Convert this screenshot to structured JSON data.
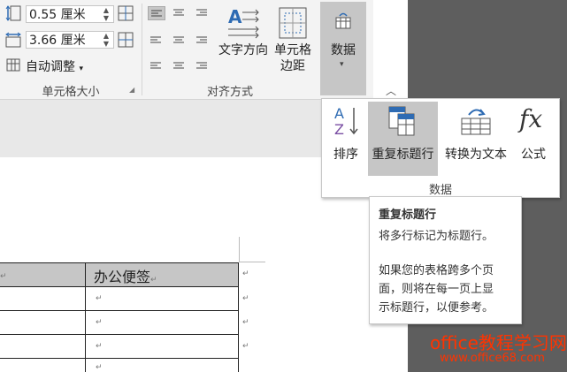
{
  "cell_size": {
    "height_value": "0.55 厘米",
    "width_value": "3.66 厘米",
    "autofit_label": "自动调整",
    "group_label": "单元格大小"
  },
  "alignment": {
    "text_direction_label": "文字方向",
    "cell_margin_label_1": "单元格",
    "cell_margin_label_2": "边距",
    "group_label": "对齐方式"
  },
  "data_button": {
    "label": "数据"
  },
  "popup": {
    "sort_label": "排序",
    "repeat_header_label": "重复标题行",
    "convert_label": "转换为文本",
    "formula_label": "公式",
    "group_label": "数据"
  },
  "tooltip": {
    "title": "重复标题行",
    "line1": "将多行标记为标题行。",
    "body_line1": "如果您的表格跨多个页",
    "body_line2": "面，则将在每一页上显",
    "body_line3": "示标题行，以便参考。"
  },
  "document": {
    "header_cell": "办公便签",
    "cell_mark": "↵"
  },
  "watermark": {
    "brand": "office教程学习网",
    "url": "www.office68.com"
  },
  "colors": {
    "ribbon_bg": "#f3f3f3",
    "data_button_bg": "#c6c6c6",
    "watermark": "#ff3300",
    "accent_blue": "#2e6bb3"
  }
}
